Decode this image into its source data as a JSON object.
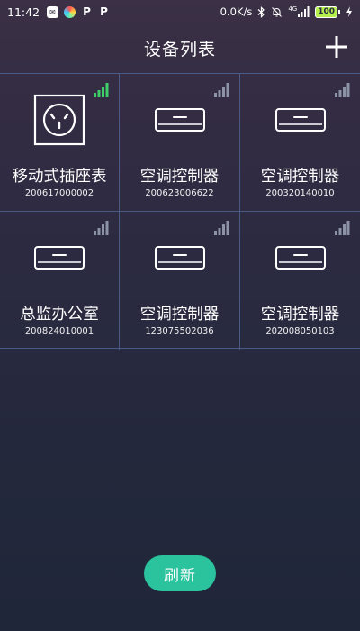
{
  "status_bar": {
    "time": "11:42",
    "apps": [
      "P",
      "P"
    ],
    "speed": "0.0K/s",
    "network": "4G",
    "battery": "100"
  },
  "header": {
    "title": "设备列表",
    "add_icon": "plus-icon"
  },
  "devices": [
    {
      "name": "移动式插座表",
      "id": "200617000002",
      "type": "socket",
      "signal_bars": 4,
      "signal_color": "#3ecf6b"
    },
    {
      "name": "空调控制器",
      "id": "200623006622",
      "type": "ac",
      "signal_bars": 4,
      "signal_color": "#8c93a6"
    },
    {
      "name": "空调控制器",
      "id": "200320140010",
      "type": "ac",
      "signal_bars": 4,
      "signal_color": "#8c93a6"
    },
    {
      "name": "总监办公室",
      "id": "200824010001",
      "type": "ac",
      "signal_bars": 4,
      "signal_color": "#8c93a6"
    },
    {
      "name": "空调控制器",
      "id": "123075502036",
      "type": "ac",
      "signal_bars": 4,
      "signal_color": "#8c93a6"
    },
    {
      "name": "空调控制器",
      "id": "202008050103",
      "type": "ac",
      "signal_bars": 4,
      "signal_color": "#8c93a6"
    }
  ],
  "refresh_button": {
    "label": "刷新",
    "color": "#2bc29e"
  },
  "colors": {
    "grid_line": "#4a5a86",
    "signal_online": "#3ecf6b",
    "signal_offline": "#8c93a6"
  }
}
